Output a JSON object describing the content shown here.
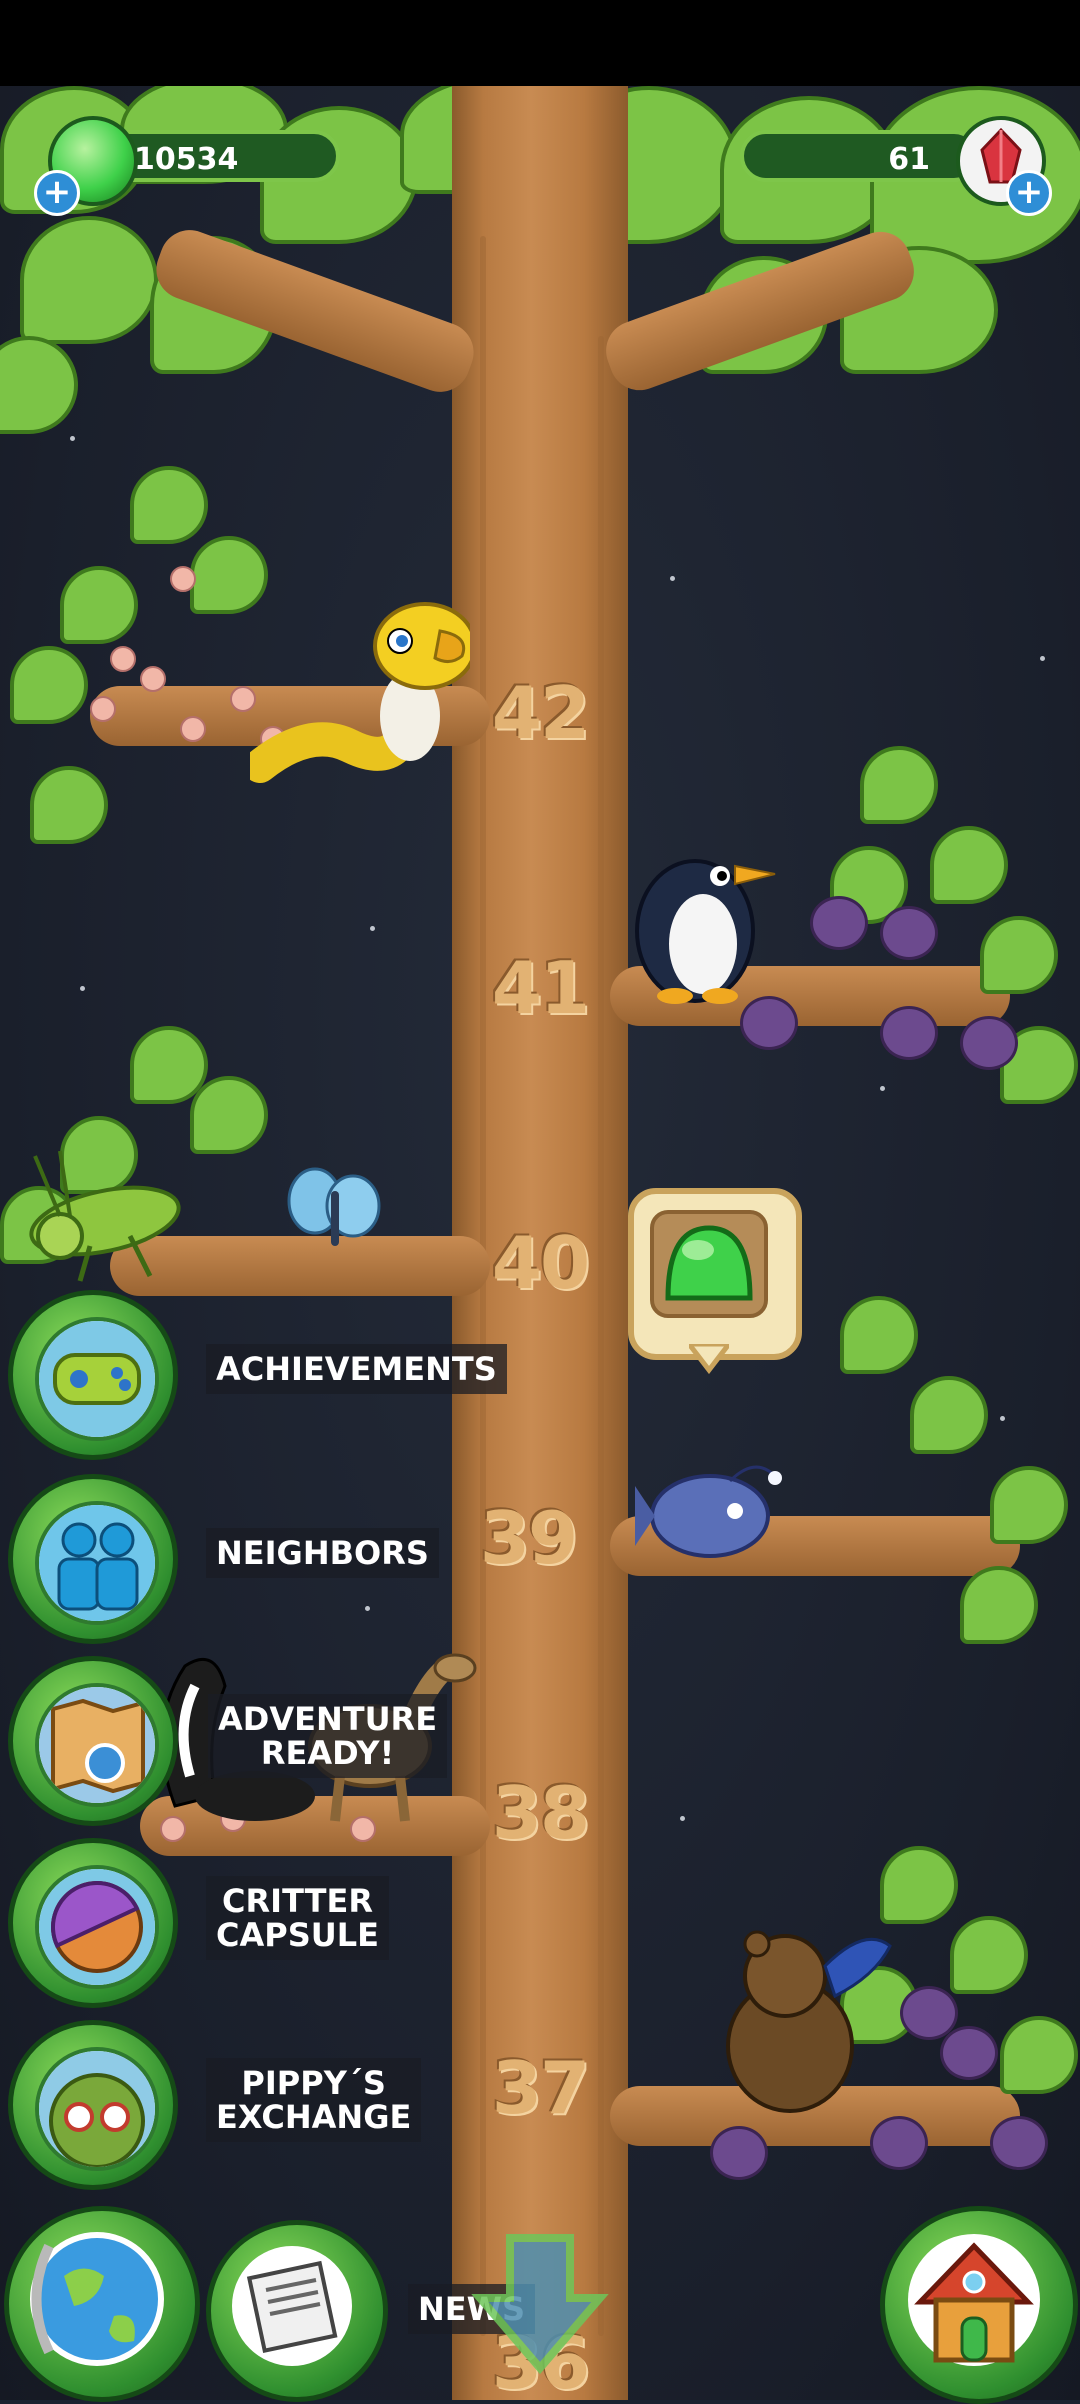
{
  "currencies": {
    "gems": "10534",
    "crystals": "61"
  },
  "tree": {
    "floors": [
      "42",
      "41",
      "40",
      "39",
      "38",
      "37",
      "36"
    ]
  },
  "menu": {
    "achievements": "ACHIEVEMENTS",
    "neighbors": "NEIGHBORS",
    "adventure_line1": "ADVENTURE",
    "adventure_line2": "READY!",
    "critter_line1": "CRITTER",
    "critter_line2": "CAPSULE",
    "pippy_line1": "PIPPY´S",
    "pippy_line2": "EXCHANGE",
    "news": "NEWS"
  },
  "colors": {
    "trunk": "#c88b52",
    "leaf": "#7cc446",
    "gem_green": "#3fd14a",
    "crystal_red": "#d9343f",
    "button_green": "#2f8f2f"
  },
  "icons": [
    "green-gem-icon",
    "red-crystal-icon",
    "plus-icon",
    "gamepad-icon",
    "neighbors-icon",
    "map-icon",
    "capsule-icon",
    "pippy-icon",
    "globe-icon",
    "newspaper-icon",
    "down-arrow-icon",
    "home-icon"
  ]
}
